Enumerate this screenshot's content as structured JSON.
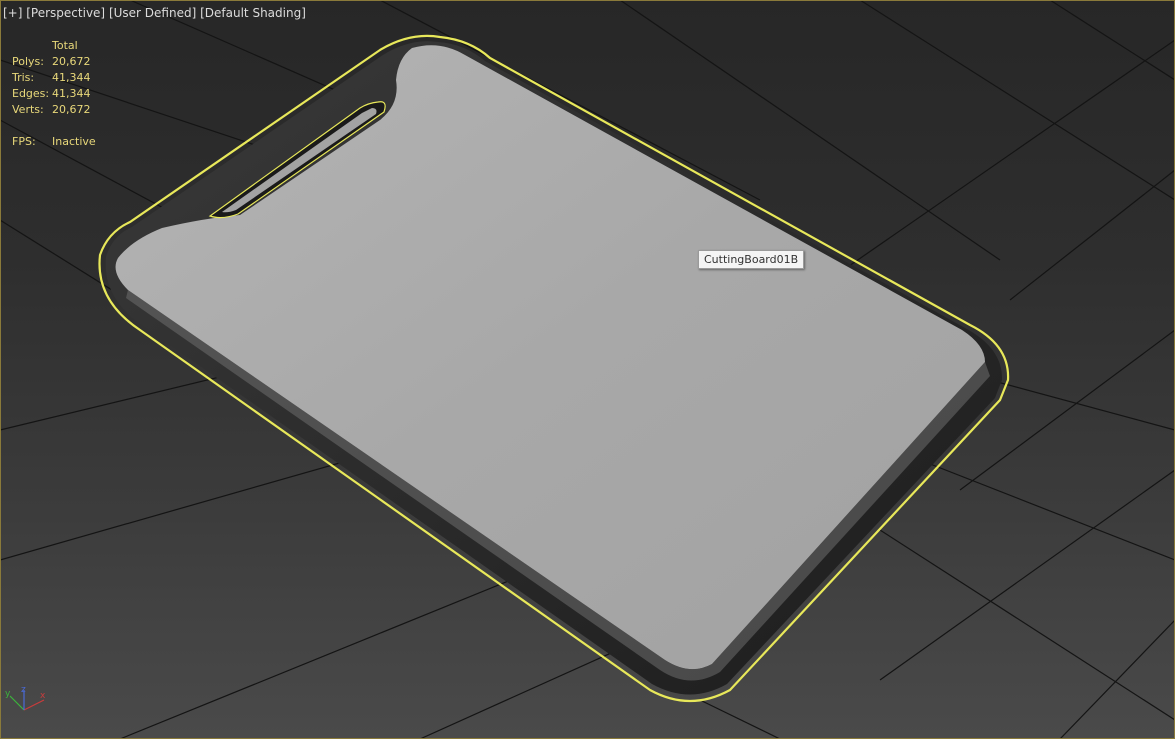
{
  "viewport": {
    "labels": [
      "[+]",
      "[Perspective]",
      "[User Defined]",
      "[Default Shading]"
    ]
  },
  "stats": {
    "header": "Total",
    "rows": [
      {
        "label": "Polys:",
        "value": "20,672"
      },
      {
        "label": "Tris:",
        "value": "41,344"
      },
      {
        "label": "Edges:",
        "value": "41,344"
      },
      {
        "label": "Verts:",
        "value": "20,672"
      }
    ],
    "fps_label": "FPS:",
    "fps_value": "Inactive"
  },
  "tooltip": {
    "object_name": "CuttingBoard01B"
  },
  "gizmo": {
    "x": "x",
    "y": "y",
    "z": "z"
  },
  "colors": {
    "selection_outline": "#e8e85a",
    "stats_text": "#e8d87a",
    "board_surface": "#a9a9a9",
    "board_rim": "#262626",
    "grid_line": "#111111",
    "axis_x": "#c83c3c",
    "axis_y": "#3cb43c",
    "axis_z": "#4a6ad8"
  }
}
